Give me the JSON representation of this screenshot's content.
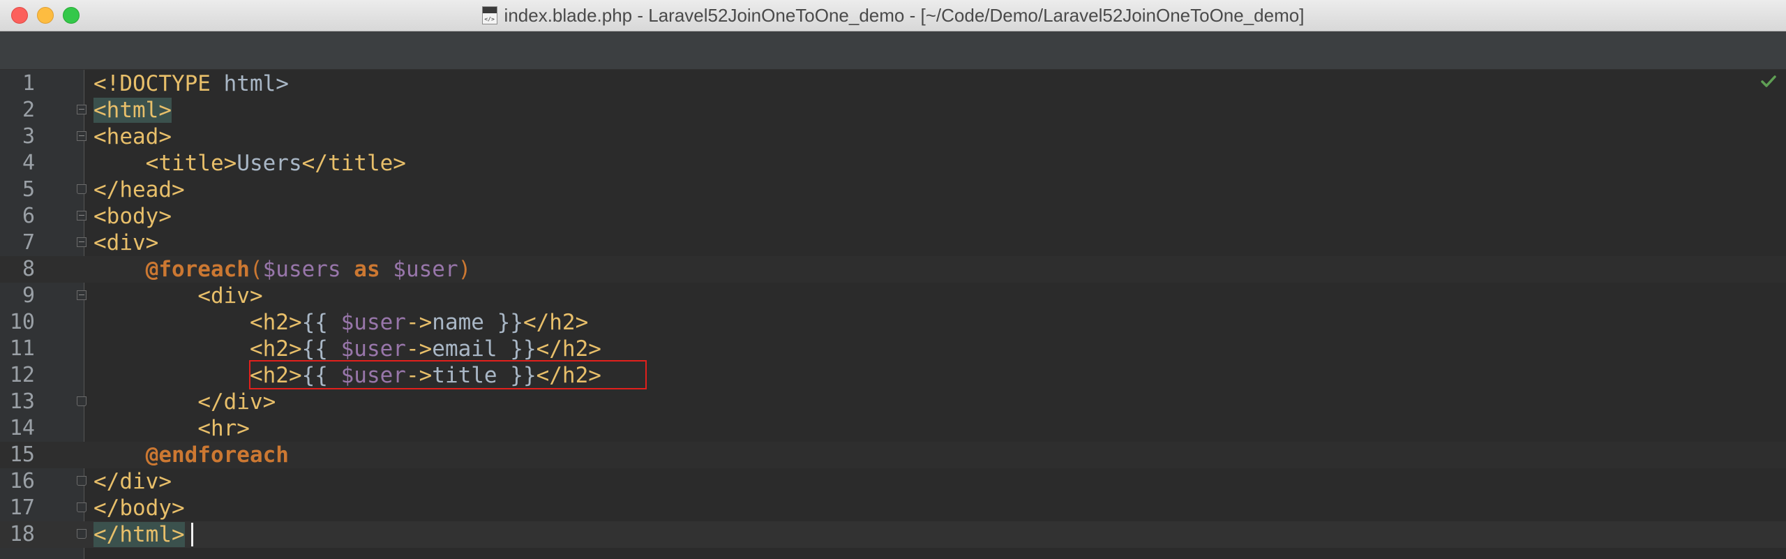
{
  "window": {
    "title": "index.blade.php - Laravel52JoinOneToOne_demo - [~/Code/Demo/Laravel52JoinOneToOne_demo]",
    "file_icon": "php-file-icon",
    "file_icon_label": "</>"
  },
  "editor": {
    "status_icon": "checkmark-icon",
    "status_color": "#5f9f54",
    "highlight_color": "#e2201c",
    "line_numbers": [
      "1",
      "2",
      "3",
      "4",
      "5",
      "6",
      "7",
      "8",
      "9",
      "10",
      "11",
      "12",
      "13",
      "14",
      "15",
      "16",
      "17",
      "18"
    ],
    "lines": {
      "l1": {
        "open": "<!DOCTYPE",
        "rest": " html>"
      },
      "l2": {
        "tag": "<html>"
      },
      "l3": {
        "tag": "<head>"
      },
      "l4": {
        "open": "<title>",
        "text": "Users",
        "close": "</title>"
      },
      "l5": {
        "tag": "</head>"
      },
      "l6": {
        "tag": "<body>"
      },
      "l7": {
        "tag": "<div>"
      },
      "l8": {
        "dir": "@foreach",
        "paren_open": "(",
        "var1": "$users",
        "kw": "as",
        "var2": "$user",
        "paren_close": ")"
      },
      "l9": {
        "tag": "<div>"
      },
      "l10": {
        "open": "<h2>",
        "braces_open": "{{",
        "var": "$user",
        "arrow": "->",
        "prop": "name",
        "braces_close": "}}",
        "close": "</h2>"
      },
      "l11": {
        "open": "<h2>",
        "braces_open": "{{",
        "var": "$user",
        "arrow": "->",
        "prop": "email",
        "braces_close": "}}",
        "close": "</h2>"
      },
      "l12": {
        "open": "<h2>",
        "braces_open": "{{",
        "var": "$user",
        "arrow": "->",
        "prop": "title",
        "braces_close": "}}",
        "close": "</h2>"
      },
      "l13": {
        "tag": "</div>"
      },
      "l14": {
        "tag": "<hr>"
      },
      "l15": {
        "dir": "@endforeach"
      },
      "l16": {
        "tag": "</div>"
      },
      "l17": {
        "tag": "</body>"
      },
      "l18": {
        "tag": "</html>"
      }
    }
  }
}
